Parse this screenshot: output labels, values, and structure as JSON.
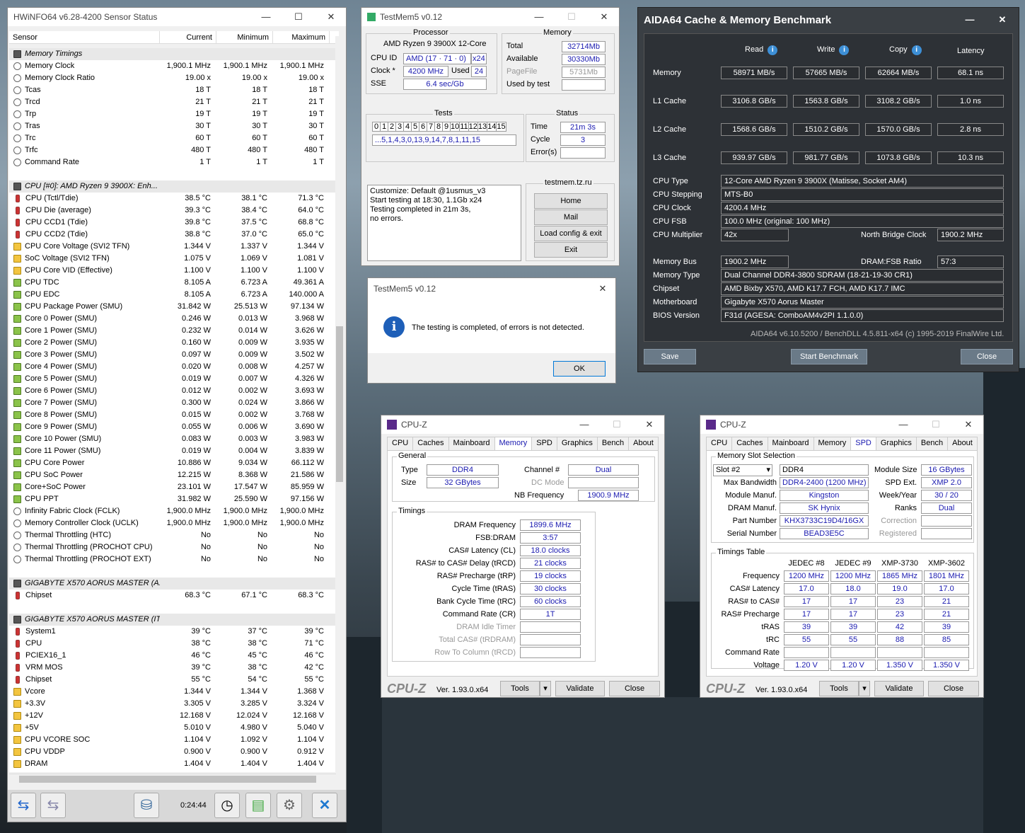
{
  "hwinfo": {
    "title": "HWiNFO64 v6.28-4200 Sensor Status",
    "columns": [
      "Sensor",
      "Current",
      "Minimum",
      "Maximum"
    ],
    "rows": [
      {
        "t": "sec",
        "n": "Memory Timings"
      },
      {
        "i": "cl",
        "n": "Memory Clock",
        "c": "1,900.1 MHz",
        "mi": "1,900.1 MHz",
        "ma": "1,900.1 MHz"
      },
      {
        "i": "cl",
        "n": "Memory Clock Ratio",
        "c": "19.00 x",
        "mi": "19.00 x",
        "ma": "19.00 x"
      },
      {
        "i": "cl",
        "n": "Tcas",
        "c": "18 T",
        "mi": "18 T",
        "ma": "18 T"
      },
      {
        "i": "cl",
        "n": "Trcd",
        "c": "21 T",
        "mi": "21 T",
        "ma": "21 T"
      },
      {
        "i": "cl",
        "n": "Trp",
        "c": "19 T",
        "mi": "19 T",
        "ma": "19 T"
      },
      {
        "i": "cl",
        "n": "Tras",
        "c": "30 T",
        "mi": "30 T",
        "ma": "30 T"
      },
      {
        "i": "cl",
        "n": "Trc",
        "c": "60 T",
        "mi": "60 T",
        "ma": "60 T"
      },
      {
        "i": "cl",
        "n": "Trfc",
        "c": "480 T",
        "mi": "480 T",
        "ma": "480 T"
      },
      {
        "i": "cl",
        "n": "Command Rate",
        "c": "1 T",
        "mi": "1 T",
        "ma": "1 T"
      },
      {
        "t": "blank"
      },
      {
        "t": "sec",
        "n": "CPU [#0]: AMD Ryzen 9 3900X: Enh..."
      },
      {
        "i": "th",
        "n": "CPU (Tctl/Tdie)",
        "c": "38.5 °C",
        "mi": "38.1 °C",
        "ma": "71.3 °C"
      },
      {
        "i": "th",
        "n": "CPU Die (average)",
        "c": "39.3 °C",
        "mi": "38.4 °C",
        "ma": "64.0 °C"
      },
      {
        "i": "th",
        "n": "CPU CCD1 (Tdie)",
        "c": "39.8 °C",
        "mi": "37.5 °C",
        "ma": "68.8 °C"
      },
      {
        "i": "th",
        "n": "CPU CCD2 (Tdie)",
        "c": "38.8 °C",
        "mi": "37.0 °C",
        "ma": "65.0 °C"
      },
      {
        "i": "vt",
        "n": "CPU Core Voltage (SVI2 TFN)",
        "c": "1.344 V",
        "mi": "1.337 V",
        "ma": "1.344 V"
      },
      {
        "i": "vt",
        "n": "SoC Voltage (SVI2 TFN)",
        "c": "1.075 V",
        "mi": "1.069 V",
        "ma": "1.081 V"
      },
      {
        "i": "vt",
        "n": "CPU Core VID (Effective)",
        "c": "1.100 V",
        "mi": "1.100 V",
        "ma": "1.100 V"
      },
      {
        "i": "pw",
        "n": "CPU TDC",
        "c": "8.105 A",
        "mi": "6.723 A",
        "ma": "49.361 A"
      },
      {
        "i": "pw",
        "n": "CPU EDC",
        "c": "8.105 A",
        "mi": "6.723 A",
        "ma": "140.000 A"
      },
      {
        "i": "pw",
        "n": "CPU Package Power (SMU)",
        "c": "31.842 W",
        "mi": "25.513 W",
        "ma": "97.134 W"
      },
      {
        "i": "pw",
        "n": "Core 0 Power (SMU)",
        "c": "0.246 W",
        "mi": "0.013 W",
        "ma": "3.968 W"
      },
      {
        "i": "pw",
        "n": "Core 1 Power (SMU)",
        "c": "0.232 W",
        "mi": "0.014 W",
        "ma": "3.626 W"
      },
      {
        "i": "pw",
        "n": "Core 2 Power (SMU)",
        "c": "0.160 W",
        "mi": "0.009 W",
        "ma": "3.935 W"
      },
      {
        "i": "pw",
        "n": "Core 3 Power (SMU)",
        "c": "0.097 W",
        "mi": "0.009 W",
        "ma": "3.502 W"
      },
      {
        "i": "pw",
        "n": "Core 4 Power (SMU)",
        "c": "0.020 W",
        "mi": "0.008 W",
        "ma": "4.257 W"
      },
      {
        "i": "pw",
        "n": "Core 5 Power (SMU)",
        "c": "0.019 W",
        "mi": "0.007 W",
        "ma": "4.326 W"
      },
      {
        "i": "pw",
        "n": "Core 6 Power (SMU)",
        "c": "0.012 W",
        "mi": "0.002 W",
        "ma": "3.693 W"
      },
      {
        "i": "pw",
        "n": "Core 7 Power (SMU)",
        "c": "0.300 W",
        "mi": "0.024 W",
        "ma": "3.866 W"
      },
      {
        "i": "pw",
        "n": "Core 8 Power (SMU)",
        "c": "0.015 W",
        "mi": "0.002 W",
        "ma": "3.768 W"
      },
      {
        "i": "pw",
        "n": "Core 9 Power (SMU)",
        "c": "0.055 W",
        "mi": "0.006 W",
        "ma": "3.690 W"
      },
      {
        "i": "pw",
        "n": "Core 10 Power (SMU)",
        "c": "0.083 W",
        "mi": "0.003 W",
        "ma": "3.983 W"
      },
      {
        "i": "pw",
        "n": "Core 11 Power (SMU)",
        "c": "0.019 W",
        "mi": "0.004 W",
        "ma": "3.839 W"
      },
      {
        "i": "pw",
        "n": "CPU Core Power",
        "c": "10.886 W",
        "mi": "9.034 W",
        "ma": "66.112 W"
      },
      {
        "i": "pw",
        "n": "CPU SoC Power",
        "c": "12.215 W",
        "mi": "8.368 W",
        "ma": "21.586 W"
      },
      {
        "i": "pw",
        "n": "Core+SoC Power",
        "c": "23.101 W",
        "mi": "17.547 W",
        "ma": "85.959 W"
      },
      {
        "i": "pw",
        "n": "CPU PPT",
        "c": "31.982 W",
        "mi": "25.590 W",
        "ma": "97.156 W"
      },
      {
        "i": "cl",
        "n": "Infinity Fabric Clock (FCLK)",
        "c": "1,900.0 MHz",
        "mi": "1,900.0 MHz",
        "ma": "1,900.0 MHz"
      },
      {
        "i": "cl",
        "n": "Memory Controller Clock (UCLK)",
        "c": "1,900.0 MHz",
        "mi": "1,900.0 MHz",
        "ma": "1,900.0 MHz"
      },
      {
        "i": "cl",
        "n": "Thermal Throttling (HTC)",
        "c": "No",
        "mi": "No",
        "ma": "No"
      },
      {
        "i": "cl",
        "n": "Thermal Throttling (PROCHOT CPU)",
        "c": "No",
        "mi": "No",
        "ma": "No"
      },
      {
        "i": "cl",
        "n": "Thermal Throttling (PROCHOT EXT)",
        "c": "No",
        "mi": "No",
        "ma": "No"
      },
      {
        "t": "blank"
      },
      {
        "t": "sec",
        "n": "GIGABYTE X570 AORUS MASTER (A..."
      },
      {
        "i": "th",
        "n": "Chipset",
        "c": "68.3 °C",
        "mi": "67.1 °C",
        "ma": "68.3 °C"
      },
      {
        "t": "blank"
      },
      {
        "t": "sec",
        "n": "GIGABYTE X570 AORUS MASTER (IT..."
      },
      {
        "i": "th",
        "n": "System1",
        "c": "39 °C",
        "mi": "37 °C",
        "ma": "39 °C"
      },
      {
        "i": "th",
        "n": "CPU",
        "c": "38 °C",
        "mi": "38 °C",
        "ma": "71 °C"
      },
      {
        "i": "th",
        "n": "PCIEX16_1",
        "c": "46 °C",
        "mi": "45 °C",
        "ma": "46 °C"
      },
      {
        "i": "th",
        "n": "VRM MOS",
        "c": "39 °C",
        "mi": "38 °C",
        "ma": "42 °C"
      },
      {
        "i": "th",
        "n": "Chipset",
        "c": "55 °C",
        "mi": "54 °C",
        "ma": "55 °C"
      },
      {
        "i": "vt",
        "n": "Vcore",
        "c": "1.344 V",
        "mi": "1.344 V",
        "ma": "1.368 V"
      },
      {
        "i": "vt",
        "n": "+3.3V",
        "c": "3.305 V",
        "mi": "3.285 V",
        "ma": "3.324 V"
      },
      {
        "i": "vt",
        "n": "+12V",
        "c": "12.168 V",
        "mi": "12.024 V",
        "ma": "12.168 V"
      },
      {
        "i": "vt",
        "n": "+5V",
        "c": "5.010 V",
        "mi": "4.980 V",
        "ma": "5.040 V"
      },
      {
        "i": "vt",
        "n": "CPU VCORE SOC",
        "c": "1.104 V",
        "mi": "1.092 V",
        "ma": "1.104 V"
      },
      {
        "i": "vt",
        "n": "CPU VDDP",
        "c": "0.900 V",
        "mi": "0.900 V",
        "ma": "0.912 V"
      },
      {
        "i": "vt",
        "n": "DRAM",
        "c": "1.404 V",
        "mi": "1.404 V",
        "ma": "1.404 V"
      }
    ],
    "timer": "0:24:44"
  },
  "testmem": {
    "title": "TestMem5 v0.12",
    "processor_label": "Processor",
    "processor": "AMD Ryzen 9 3900X 12-Core",
    "cpuid_label": "CPU ID",
    "cpuid": "AMD  (17 · 71 · 0)",
    "threads": "x24",
    "clock_label": "Clock *",
    "clock": "4200 MHz",
    "used_label": "Used",
    "used": "24",
    "sse_label": "SSE",
    "sse": "6.4 sec/Gb",
    "memory_label": "Memory",
    "total_label": "Total",
    "total": "32714Mb",
    "avail_label": "Available",
    "avail": "30330Mb",
    "pagefile_label": "PageFile",
    "pagefile": "5731Mb",
    "usedtest_label": "Used by test",
    "tests_label": "Tests",
    "test_nums": [
      "0",
      "1",
      "2",
      "3",
      "4",
      "5",
      "6",
      "7",
      "8",
      "9",
      "10",
      "11",
      "12",
      "13",
      "14",
      "15"
    ],
    "sequence": "...5,1,4,3,0,13,9,14,7,8,1,11,15",
    "status_label": "Status",
    "time_label": "Time",
    "time": "21m 3s",
    "cycle_label": "Cycle",
    "cycle": "3",
    "errors_label": "Error(s)",
    "log": [
      "Customize: Default @1usmus_v3",
      "Start testing at 18:30, 1.1Gb x24",
      "Testing completed in 21m 3s,",
      "no errors."
    ],
    "site": "testmem.tz.ru",
    "buttons": [
      "Home",
      "Mail",
      "Load config & exit",
      "Exit"
    ]
  },
  "dialog": {
    "title": "TestMem5 v0.12",
    "message": "The testing is completed, of errors is not detected.",
    "ok": "OK"
  },
  "aida": {
    "title": "AIDA64 Cache & Memory Benchmark",
    "cols": [
      "Read",
      "Write",
      "Copy",
      "Latency"
    ],
    "rows": [
      {
        "n": "Memory",
        "v": [
          "58971 MB/s",
          "57665 MB/s",
          "62664 MB/s",
          "68.1 ns"
        ]
      },
      {
        "n": "L1 Cache",
        "v": [
          "3106.8 GB/s",
          "1563.8 GB/s",
          "3108.2 GB/s",
          "1.0 ns"
        ]
      },
      {
        "n": "L2 Cache",
        "v": [
          "1568.6 GB/s",
          "1510.2 GB/s",
          "1570.0 GB/s",
          "2.8 ns"
        ]
      },
      {
        "n": "L3 Cache",
        "v": [
          "939.97 GB/s",
          "981.77 GB/s",
          "1073.8 GB/s",
          "10.3 ns"
        ]
      }
    ],
    "cpu_type_l": "CPU Type",
    "cpu_type": "12-Core AMD Ryzen 9 3900X  (Matisse, Socket AM4)",
    "cpu_step_l": "CPU Stepping",
    "cpu_step": "MTS-B0",
    "cpu_clock_l": "CPU Clock",
    "cpu_clock": "4200.4 MHz",
    "cpu_fsb_l": "CPU FSB",
    "cpu_fsb": "100.0 MHz  (original: 100 MHz)",
    "cpu_mult_l": "CPU Multiplier",
    "cpu_mult": "42x",
    "nb_l": "North Bridge Clock",
    "nb": "1900.2 MHz",
    "mem_bus_l": "Memory Bus",
    "mem_bus": "1900.2 MHz",
    "ratio_l": "DRAM:FSB Ratio",
    "ratio": "57:3",
    "mem_type_l": "Memory Type",
    "mem_type": "Dual Channel DDR4-3800 SDRAM  (18-21-19-30 CR1)",
    "chipset_l": "Chipset",
    "chipset": "AMD Bixby X570, AMD K17.7 FCH, AMD K17.7 IMC",
    "mobo_l": "Motherboard",
    "mobo": "Gigabyte X570 Aorus Master",
    "bios_l": "BIOS Version",
    "bios": "F31d  (AGESA: ComboAM4v2PI 1.1.0.0)",
    "footer": "AIDA64 v6.10.5200 / BenchDLL 4.5.811-x64  (c) 1995-2019 FinalWire Ltd.",
    "save": "Save",
    "start": "Start Benchmark",
    "close": "Close"
  },
  "cpuz1": {
    "title": "CPU-Z",
    "tabs": [
      "CPU",
      "Caches",
      "Mainboard",
      "Memory",
      "SPD",
      "Graphics",
      "Bench",
      "About"
    ],
    "general": "General",
    "type_l": "Type",
    "type": "DDR4",
    "size_l": "Size",
    "size": "32 GBytes",
    "chan_l": "Channel #",
    "chan": "Dual",
    "dc_l": "DC Mode",
    "nbf_l": "NB Frequency",
    "nbf": "1900.9 MHz",
    "timings": "Timings",
    "trows": [
      {
        "l": "DRAM Frequency",
        "v": "1899.6 MHz"
      },
      {
        "l": "FSB:DRAM",
        "v": "3:57"
      },
      {
        "l": "CAS# Latency (CL)",
        "v": "18.0 clocks"
      },
      {
        "l": "RAS# to CAS# Delay (tRCD)",
        "v": "21 clocks"
      },
      {
        "l": "RAS# Precharge (tRP)",
        "v": "19 clocks"
      },
      {
        "l": "Cycle Time (tRAS)",
        "v": "30 clocks"
      },
      {
        "l": "Bank Cycle Time (tRC)",
        "v": "60 clocks"
      },
      {
        "l": "Command Rate (CR)",
        "v": "1T"
      },
      {
        "l": "DRAM Idle Timer",
        "v": ""
      },
      {
        "l": "Total CAS# (tRDRAM)",
        "v": ""
      },
      {
        "l": "Row To Column (tRCD)",
        "v": ""
      }
    ],
    "logo": "CPU-Z",
    "ver": "Ver. 1.93.0.x64",
    "tools": "Tools",
    "validate": "Validate",
    "close": "Close"
  },
  "cpuz2": {
    "title": "CPU-Z",
    "tabs": [
      "CPU",
      "Caches",
      "Mainboard",
      "Memory",
      "SPD",
      "Graphics",
      "Bench",
      "About"
    ],
    "slotsel": "Memory Slot Selection",
    "slot": "Slot #2",
    "mtype": "DDR4",
    "modsize_l": "Module Size",
    "modsize": "16 GBytes",
    "maxbw_l": "Max Bandwidth",
    "maxbw": "DDR4-2400 (1200 MHz)",
    "spdext_l": "SPD Ext.",
    "spdext": "XMP 2.0",
    "manuf_l": "Module Manuf.",
    "manuf": "Kingston",
    "week_l": "Week/Year",
    "week": "30 / 20",
    "dram_l": "DRAM Manuf.",
    "dram": "SK Hynix",
    "ranks_l": "Ranks",
    "ranks": "Dual",
    "part_l": "Part Number",
    "part": "KHX3733C19D4/16GX",
    "corr_l": "Correction",
    "serial_l": "Serial Number",
    "serial": "BEAD3E5C",
    "reg_l": "Registered",
    "ttable": "Timings Table",
    "tcols": [
      "JEDEC #8",
      "JEDEC #9",
      "XMP-3730",
      "XMP-3602"
    ],
    "trows": [
      {
        "l": "Frequency",
        "v": [
          "1200 MHz",
          "1200 MHz",
          "1865 MHz",
          "1801 MHz"
        ]
      },
      {
        "l": "CAS# Latency",
        "v": [
          "17.0",
          "18.0",
          "19.0",
          "17.0"
        ]
      },
      {
        "l": "RAS# to CAS#",
        "v": [
          "17",
          "17",
          "23",
          "21"
        ]
      },
      {
        "l": "RAS# Precharge",
        "v": [
          "17",
          "17",
          "23",
          "21"
        ]
      },
      {
        "l": "tRAS",
        "v": [
          "39",
          "39",
          "42",
          "39"
        ]
      },
      {
        "l": "tRC",
        "v": [
          "55",
          "55",
          "88",
          "85"
        ]
      },
      {
        "l": "Command Rate",
        "v": [
          "",
          "",
          "",
          ""
        ]
      },
      {
        "l": "Voltage",
        "v": [
          "1.20 V",
          "1.20 V",
          "1.350 V",
          "1.350 V"
        ]
      }
    ],
    "logo": "CPU-Z",
    "ver": "Ver. 1.93.0.x64",
    "tools": "Tools",
    "validate": "Validate",
    "close": "Close"
  }
}
